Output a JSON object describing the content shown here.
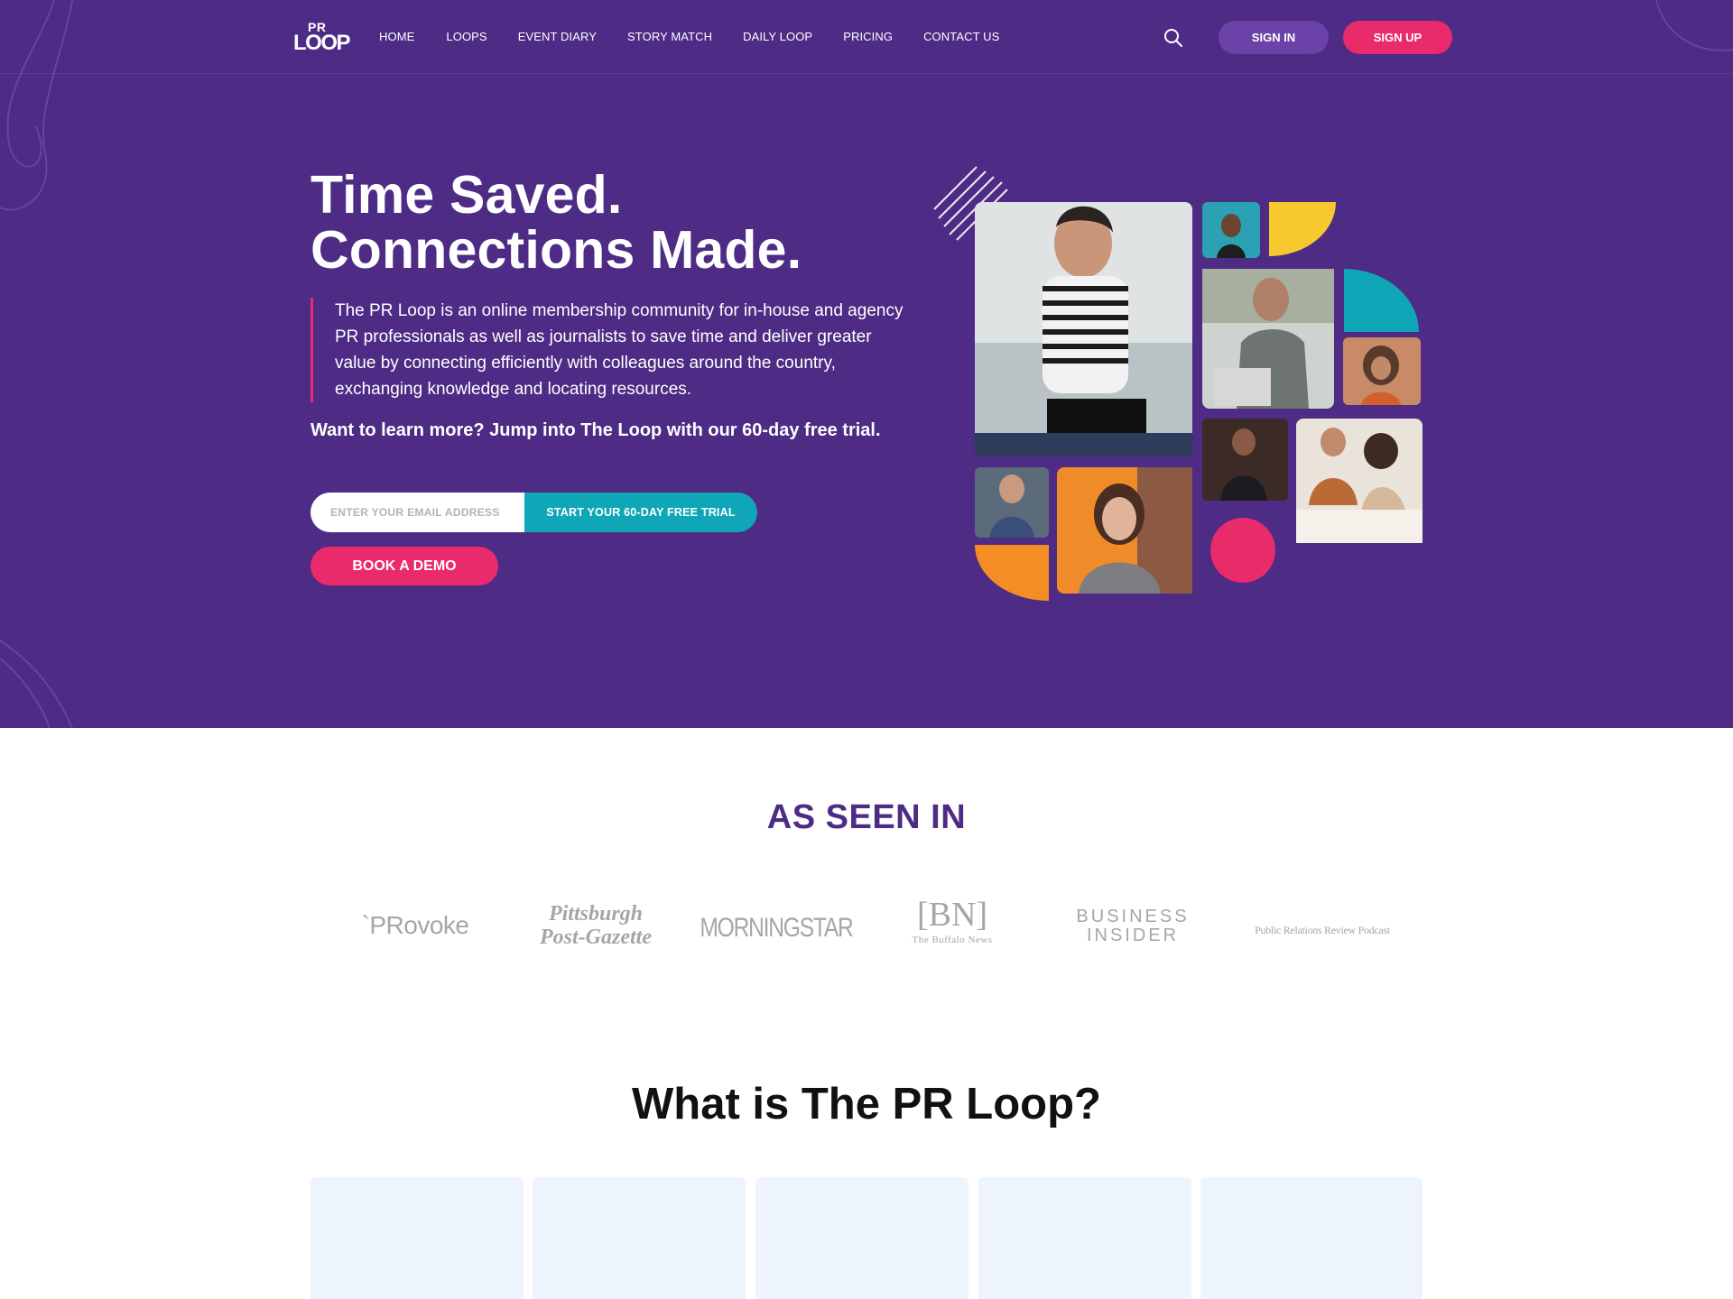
{
  "brand": {
    "logo_top": "PR",
    "logo_bottom": "LOOP",
    "primary": "#4e2b85",
    "accent_pink": "#ea2b6b",
    "accent_teal": "#0fa7b8",
    "accent_yellow": "#f6c92e",
    "accent_orange": "#f48e24"
  },
  "nav": {
    "items": [
      {
        "label": "HOME"
      },
      {
        "label": "LOOPS"
      },
      {
        "label": "EVENT DIARY"
      },
      {
        "label": "STORY MATCH"
      },
      {
        "label": "DAILY LOOP"
      },
      {
        "label": "PRICING"
      },
      {
        "label": "CONTACT US"
      }
    ],
    "search_icon": "search-icon",
    "signin_label": "SIGN IN",
    "signup_label": "SIGN UP"
  },
  "hero": {
    "title_line1": "Time Saved.",
    "title_line2": "Connections Made.",
    "description": "The PR Loop is an online membership community for in-house and agency PR professionals as well as journalists to save time and deliver greater value by connecting efficiently with colleagues around the country, exchanging knowledge and locating resources.",
    "cta_text": "Want to learn more? Jump into The Loop with our 60-day free trial.",
    "email_placeholder": "ENTER YOUR EMAIL ADDRESS",
    "trial_button": "START YOUR 60-DAY FREE TRIAL",
    "demo_button": "BOOK A DEMO"
  },
  "seen_in": {
    "title": "AS SEEN IN",
    "logos": [
      {
        "name": "`PRovoke"
      },
      {
        "line1": "Pittsburgh",
        "line2": "Post-Gazette"
      },
      {
        "name": "MORNINGSTAR"
      },
      {
        "mark": "[BN]",
        "sub": "The Buffalo News"
      },
      {
        "line1": "BUSINESS",
        "line2": "INSIDER"
      },
      {
        "name": "Public Relations Review Podcast"
      }
    ]
  },
  "what_is": {
    "title": "What is The PR Loop?"
  }
}
